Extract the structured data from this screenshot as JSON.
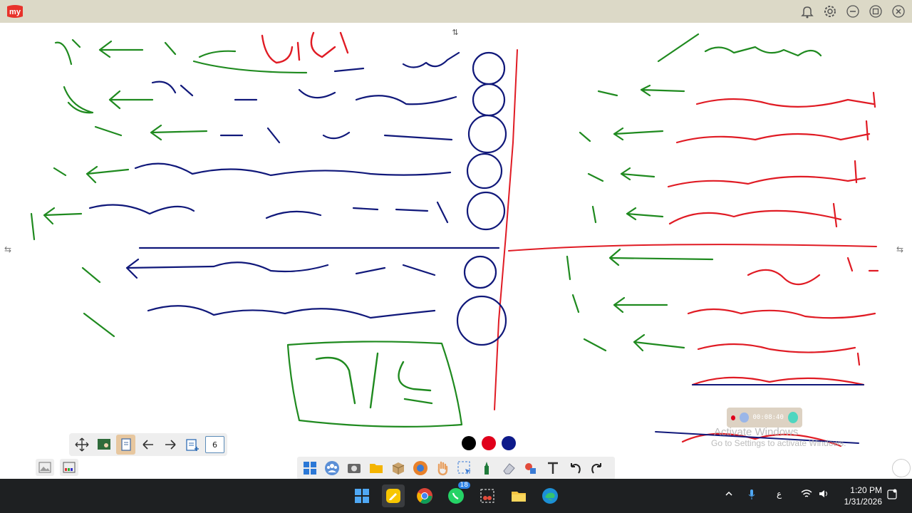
{
  "titlebar": {
    "logo_text": "my",
    "icons": [
      "bell-icon",
      "gear-icon",
      "minimize-icon",
      "restore-icon",
      "close-icon"
    ]
  },
  "toolbar": {
    "page_number": "6",
    "buttons": [
      "move-icon",
      "board-icon",
      "document-icon",
      "back-arrow-icon",
      "forward-arrow-icon",
      "add-page-icon"
    ]
  },
  "colors": {
    "pen_colors": [
      "#000000",
      "#e0001b",
      "#0d1a8a"
    ],
    "ink_green": "#1f8a1f",
    "ink_red": "#e01b24",
    "ink_navy": "#10187a"
  },
  "recorder": {
    "elapsed": "00:08:40"
  },
  "watermark": {
    "title": "Activate Windows",
    "subtitle": "Go to Settings to activate Windows."
  },
  "taskbar": {
    "whatsapp_badge": "18",
    "language": "ع",
    "time": "1:20 PM",
    "date": "1/31/2026"
  }
}
